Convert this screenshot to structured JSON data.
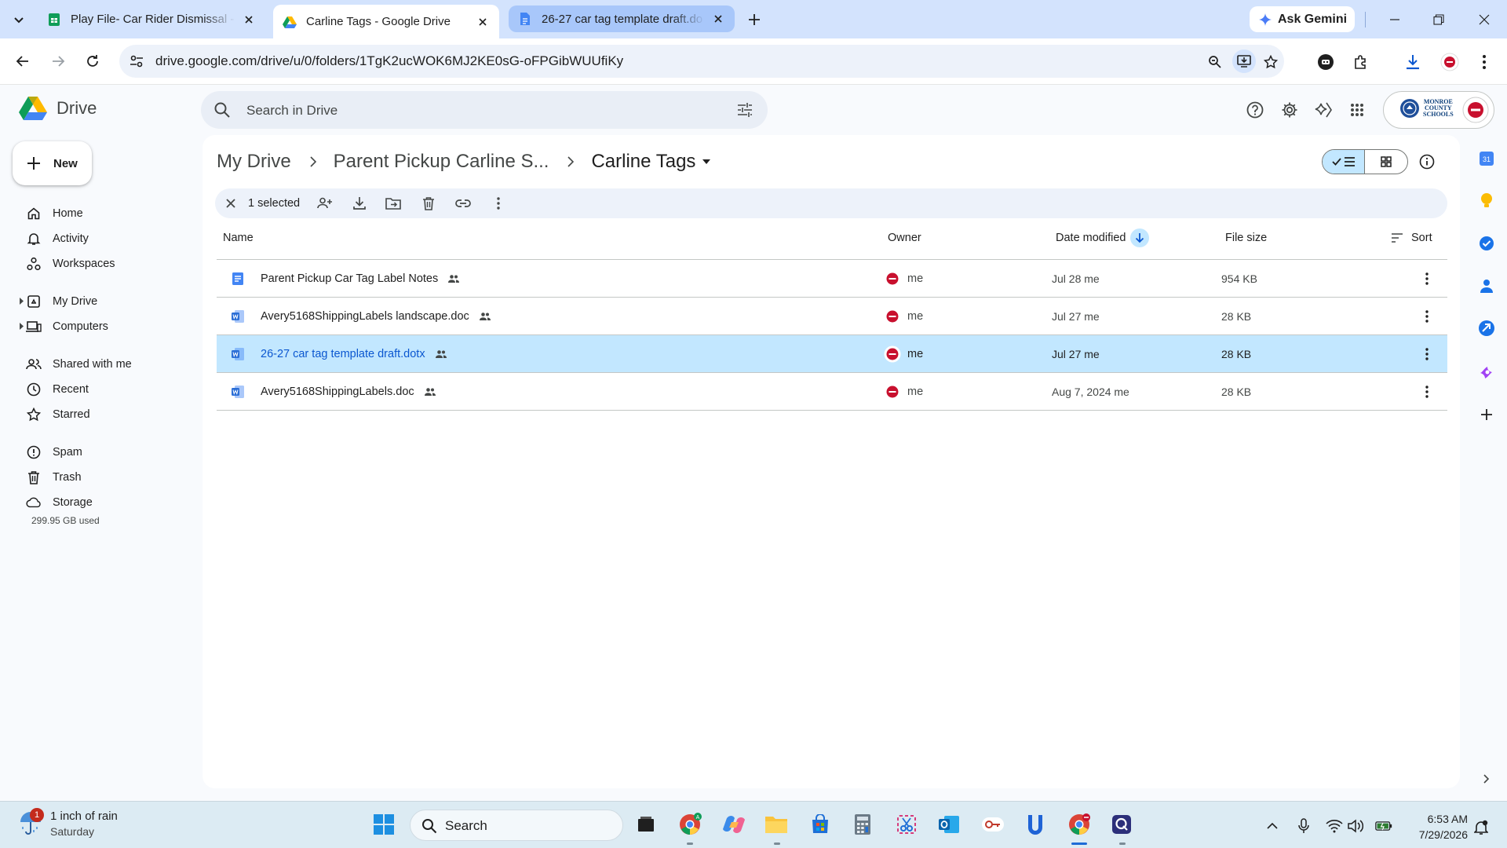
{
  "browser": {
    "tabs": [
      {
        "title": "Play File- Car Rider Dismissal - F",
        "favicon": "sheets-icon"
      },
      {
        "title": "Carline Tags - Google Drive",
        "favicon": "drive-icon"
      },
      {
        "title": "26-27 car tag template draft.do",
        "favicon": "docs-icon"
      }
    ],
    "ask_gemini": "Ask Gemini",
    "url": "drive.google.com/drive/u/0/folders/1TgK2ucWOK6MJ2KE0sG-oFPGibWUUfiKy"
  },
  "drive": {
    "app_name": "Drive",
    "search_placeholder": "Search in Drive",
    "org_name_line1": "MONROE",
    "org_name_line2": "COUNTY",
    "org_name_line3": "SCHOOLS",
    "new_label": "New",
    "nav": [
      {
        "label": "Home",
        "icon": "home-icon"
      },
      {
        "label": "Activity",
        "icon": "bell-icon"
      },
      {
        "label": "Workspaces",
        "icon": "workspaces-icon"
      },
      {
        "label": "My Drive",
        "icon": "my-drive-icon"
      },
      {
        "label": "Computers",
        "icon": "computers-icon"
      },
      {
        "label": "Shared with me",
        "icon": "people-icon"
      },
      {
        "label": "Recent",
        "icon": "clock-icon"
      },
      {
        "label": "Starred",
        "icon": "star-icon"
      },
      {
        "label": "Spam",
        "icon": "spam-icon"
      },
      {
        "label": "Trash",
        "icon": "trash-icon"
      },
      {
        "label": "Storage",
        "icon": "cloud-icon"
      }
    ],
    "storage_used": "299.95 GB used",
    "breadcrumb": [
      "My Drive",
      "Parent Pickup Carline S...",
      "Carline Tags"
    ],
    "selection_count": "1 selected",
    "columns": {
      "name": "Name",
      "owner": "Owner",
      "date": "Date modified",
      "size": "File size",
      "sort": "Sort"
    },
    "files": [
      {
        "name": "Parent Pickup Car Tag Label Notes",
        "type": "gdoc",
        "owner": "me",
        "date": "Jul 28 me",
        "size": "954 KB",
        "selected": false
      },
      {
        "name": "Avery5168ShippingLabels landscape.doc",
        "type": "word",
        "owner": "me",
        "date": "Jul 27 me",
        "size": "28 KB",
        "selected": false
      },
      {
        "name": "26-27 car tag template draft.dotx",
        "type": "word",
        "owner": "me",
        "date": "Jul 27 me",
        "size": "28 KB",
        "selected": true
      },
      {
        "name": "Avery5168ShippingLabels.doc",
        "type": "word",
        "owner": "me",
        "date": "Aug 7, 2024 me",
        "size": "28 KB",
        "selected": false
      }
    ]
  },
  "taskbar": {
    "weather_line1": "1 inch of rain",
    "weather_line2": "Saturday",
    "weather_badge": "1",
    "search_placeholder": "Search",
    "time": "6:53 AM",
    "date": "7/29/2026"
  },
  "colors": {
    "accent": "#0b57d0",
    "selected_row": "#c2e7ff",
    "tabstrip": "#d3e3fd"
  }
}
